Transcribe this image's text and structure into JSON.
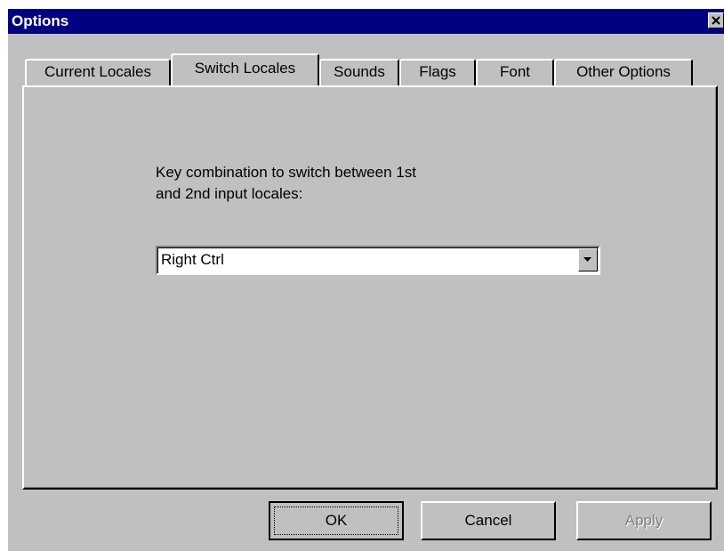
{
  "window": {
    "title": "Options"
  },
  "tabs": [
    {
      "label": "Current Locales",
      "active": false
    },
    {
      "label": "Switch Locales",
      "active": true
    },
    {
      "label": "Sounds",
      "active": false
    },
    {
      "label": "Flags",
      "active": false
    },
    {
      "label": "Font",
      "active": false
    },
    {
      "label": "Other Options",
      "active": false
    }
  ],
  "panel": {
    "description_line1": "Key combination to switch between 1st",
    "description_line2": "and 2nd input locales:",
    "combo_value": "Right Ctrl"
  },
  "buttons": {
    "ok": "OK",
    "cancel": "Cancel",
    "apply": "Apply",
    "apply_disabled": true
  },
  "colors": {
    "titlebar": "#000080",
    "face": "#c0c0c0"
  },
  "icons": {
    "close": "close-icon",
    "dropdown": "chevron-down-icon"
  }
}
